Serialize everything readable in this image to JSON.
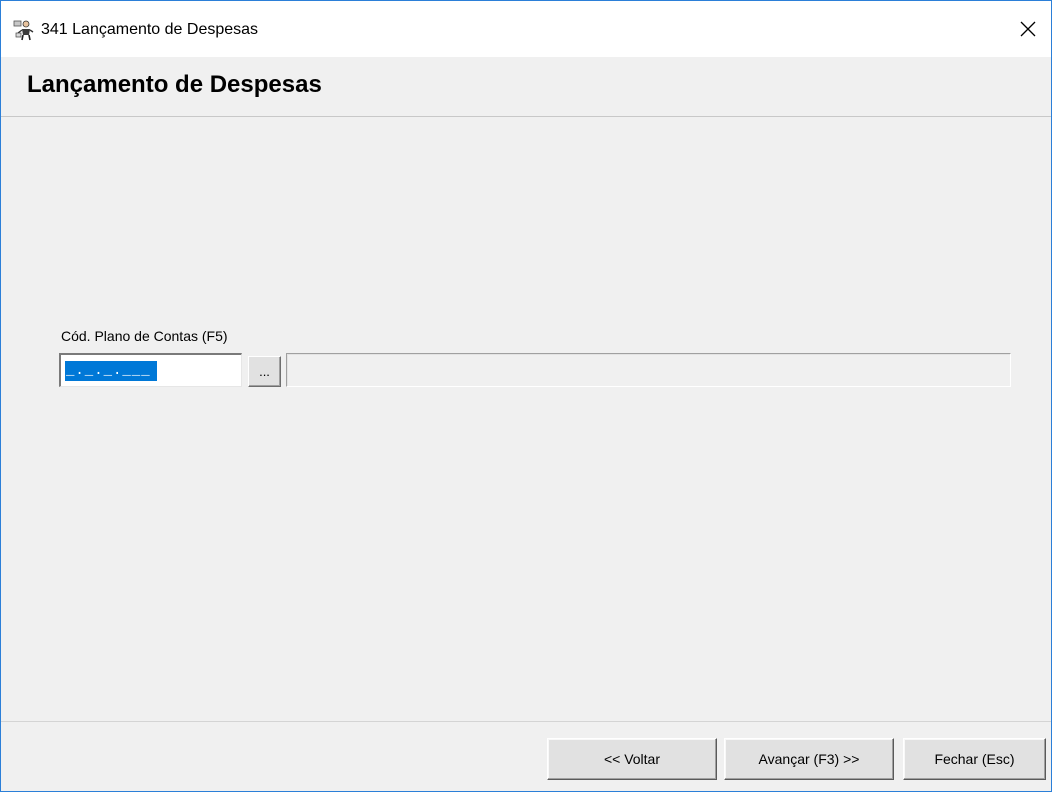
{
  "window": {
    "title": "341 Lançamento de Despesas",
    "close_icon": "close-icon",
    "app_icon": "app-person-icon"
  },
  "header": {
    "title": "Lançamento de Despesas"
  },
  "form": {
    "field_label": "Cód. Plano de Contas (F5)",
    "code_value": "_._._.___",
    "lookup_label": "...",
    "description_value": ""
  },
  "footer": {
    "back_label": "<< Voltar",
    "next_label": "Avançar (F3) >>",
    "close_label": "Fechar (Esc)"
  },
  "colors": {
    "selection": "#0078d7",
    "window_border": "#2b7fd8",
    "background": "#f0f0f0"
  }
}
